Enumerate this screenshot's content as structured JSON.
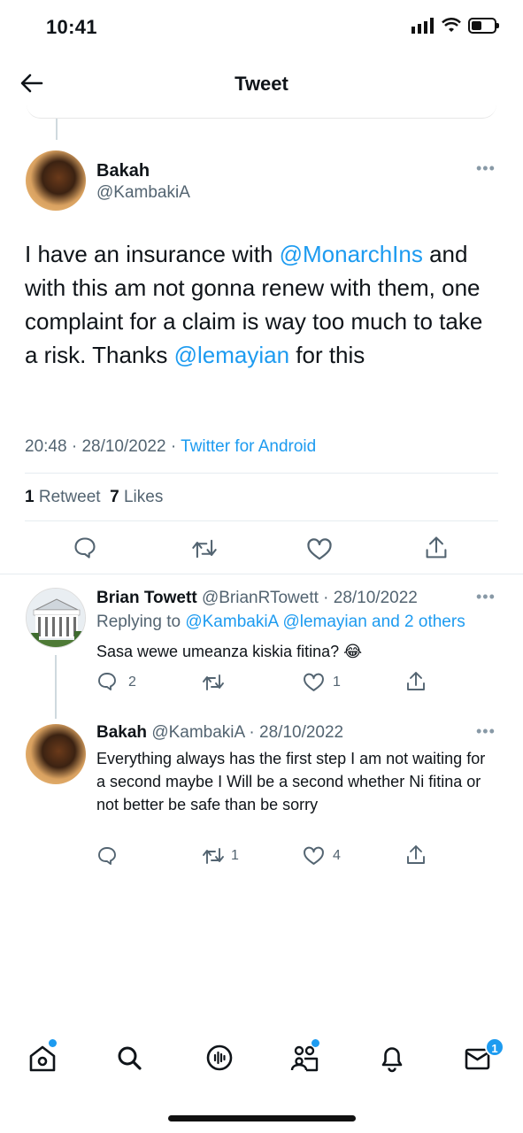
{
  "status_bar": {
    "time": "10:41"
  },
  "header": {
    "title": "Tweet"
  },
  "main_tweet": {
    "name": "Bakah",
    "handle": "@KambakiA",
    "text_1": "I have an insurance with ",
    "mention_1": "@MonarchIns",
    "text_2": " and with this am not gonna renew with them, one complaint for a claim is way too much to take a risk. Thanks ",
    "mention_2": "@lemayian",
    "text_3": " for this",
    "time": "20:48",
    "date": "28/10/2022",
    "separator": "·",
    "source": "Twitter for Android",
    "retweets_count": "1",
    "retweets_label": "Retweet",
    "likes_count": "7",
    "likes_label": "Likes"
  },
  "replies": [
    {
      "name": "Brian Towett",
      "handle_date": "@BrianRTowett · 28/10/2022",
      "replying_prefix": "Replying to",
      "replying_to": "@KambakiA @lemayian and 2 others",
      "text": "Sasa wewe umeanza kiskia fitina? 😂",
      "reply_count": "2",
      "retweet_count": "",
      "like_count": "1"
    },
    {
      "name": "Bakah",
      "handle_date": "@KambakiA · 28/10/2022",
      "text": "Everything always has the first step I am not waiting for a second maybe I Will be a second whether Ni fitina or not better be safe than be sorry",
      "reply_count": "",
      "retweet_count": "1",
      "like_count": "4"
    }
  ],
  "tab_bar": {
    "messages_badge": "1"
  },
  "colors": {
    "accent": "#1d9bf0",
    "text": "#0f1419",
    "secondary": "#536471",
    "divider": "#e6ecf0"
  },
  "more_glyph": "•••"
}
